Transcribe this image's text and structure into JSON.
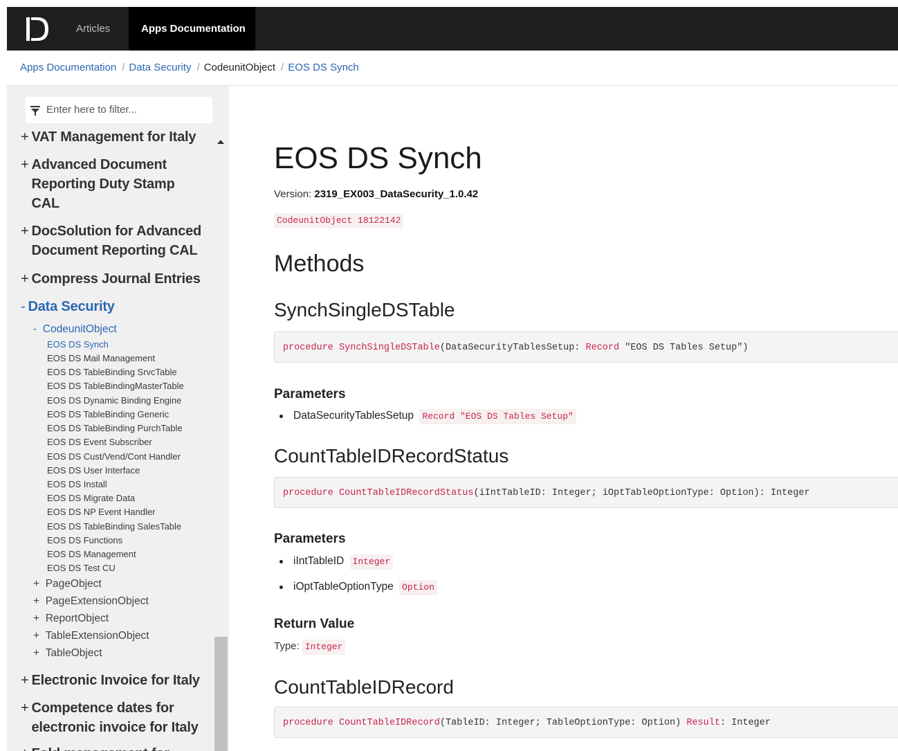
{
  "nav": {
    "logo_icon": "brand-logo-icon",
    "articles_label": "Articles",
    "apps_label": "Apps Documentation"
  },
  "breadcrumb": {
    "items": [
      "Apps Documentation",
      "Data Security",
      "CodeunitObject",
      "EOS DS Synch"
    ],
    "separator": "/"
  },
  "sidebar": {
    "filter_placeholder": "Enter here to filter...",
    "filter_icon": "filter-icon",
    "top_items": [
      {
        "prefix": "+",
        "lines": [
          "VAT Management for Italy"
        ]
      },
      {
        "prefix": "+",
        "lines": [
          "Advanced Document",
          "Reporting Duty Stamp",
          "CAL"
        ]
      },
      {
        "prefix": "+",
        "lines": [
          "DocSolution for Advanced",
          "Document Reporting CAL"
        ]
      },
      {
        "prefix": "+",
        "lines": [
          "Compress Journal Entries"
        ]
      },
      {
        "prefix": "-",
        "lines": [
          "Data Security"
        ]
      },
      {
        "prefix": "+",
        "lines": [
          "Electronic Invoice for Italy"
        ]
      },
      {
        "prefix": "+",
        "lines": [
          "Competence dates for",
          "electronic invoice for Italy"
        ]
      },
      {
        "prefix": "+",
        "lines": [
          "Fold management for"
        ]
      }
    ],
    "sub_items": [
      {
        "prefix": "-",
        "label": "CodeunitObject"
      },
      {
        "prefix": "+",
        "label": "PageObject"
      },
      {
        "prefix": "+",
        "label": "PageExtensionObject"
      },
      {
        "prefix": "+",
        "label": "ReportObject"
      },
      {
        "prefix": "+",
        "label": "TableExtensionObject"
      },
      {
        "prefix": "+",
        "label": "TableObject"
      }
    ],
    "codeunits": [
      "EOS DS Synch",
      "EOS DS Mail Management",
      "EOS DS TableBinding SrvcTable",
      "EOS DS TableBindingMasterTable",
      "EOS DS Dynamic Binding Engine",
      "EOS DS TableBinding Generic",
      "EOS DS TableBinding PurchTable",
      "EOS DS Event Subscriber",
      "EOS DS Cust/Vend/Cont Handler",
      "EOS DS User Interface",
      "EOS DS Install",
      "EOS DS Migrate Data",
      "EOS DS NP Event Handler",
      "EOS DS TableBinding SalesTable",
      "EOS DS Functions",
      "EOS DS Management",
      "EOS DS Test CU"
    ]
  },
  "content": {
    "title": "EOS DS Synch",
    "version_label": "Version:",
    "version_value": "2319_EX003_DataSecurity_1.0.42",
    "object_tag": "CodeunitObject 18122142",
    "methods_heading": "Methods",
    "parameters_heading": "Parameters",
    "return_heading": "Return Value",
    "type_label": "Type:",
    "methods": [
      {
        "name": "SynchSingleDSTable",
        "signature": {
          "keyword": "procedure",
          "fname": "SynchSingleDSTable",
          "args": "(DataSecurityTablesSetup: ",
          "type_kw": "Record",
          "rest": " \"EOS DS Tables Setup\")"
        },
        "params": [
          {
            "name": "DataSecurityTablesSetup",
            "type": "Record \"EOS DS Tables Setup\""
          }
        ]
      },
      {
        "name": "CountTableIDRecordStatus",
        "signature": {
          "keyword": "procedure",
          "fname": "CountTableIDRecordStatus",
          "rest": "(iIntTableID: Integer; iOptTableOptionType: Option): Integer"
        },
        "params": [
          {
            "name": "iIntTableID",
            "type": "Integer"
          },
          {
            "name": "iOptTableOptionType",
            "type": "Option"
          }
        ],
        "return_type": "Integer"
      },
      {
        "name": "CountTableIDRecord",
        "signature": {
          "keyword": "procedure",
          "fname": "CountTableIDRecord",
          "args": "(TableID: Integer; TableOptionType: Option) ",
          "result_kw": "Result",
          "rest": ": Integer"
        }
      }
    ]
  }
}
